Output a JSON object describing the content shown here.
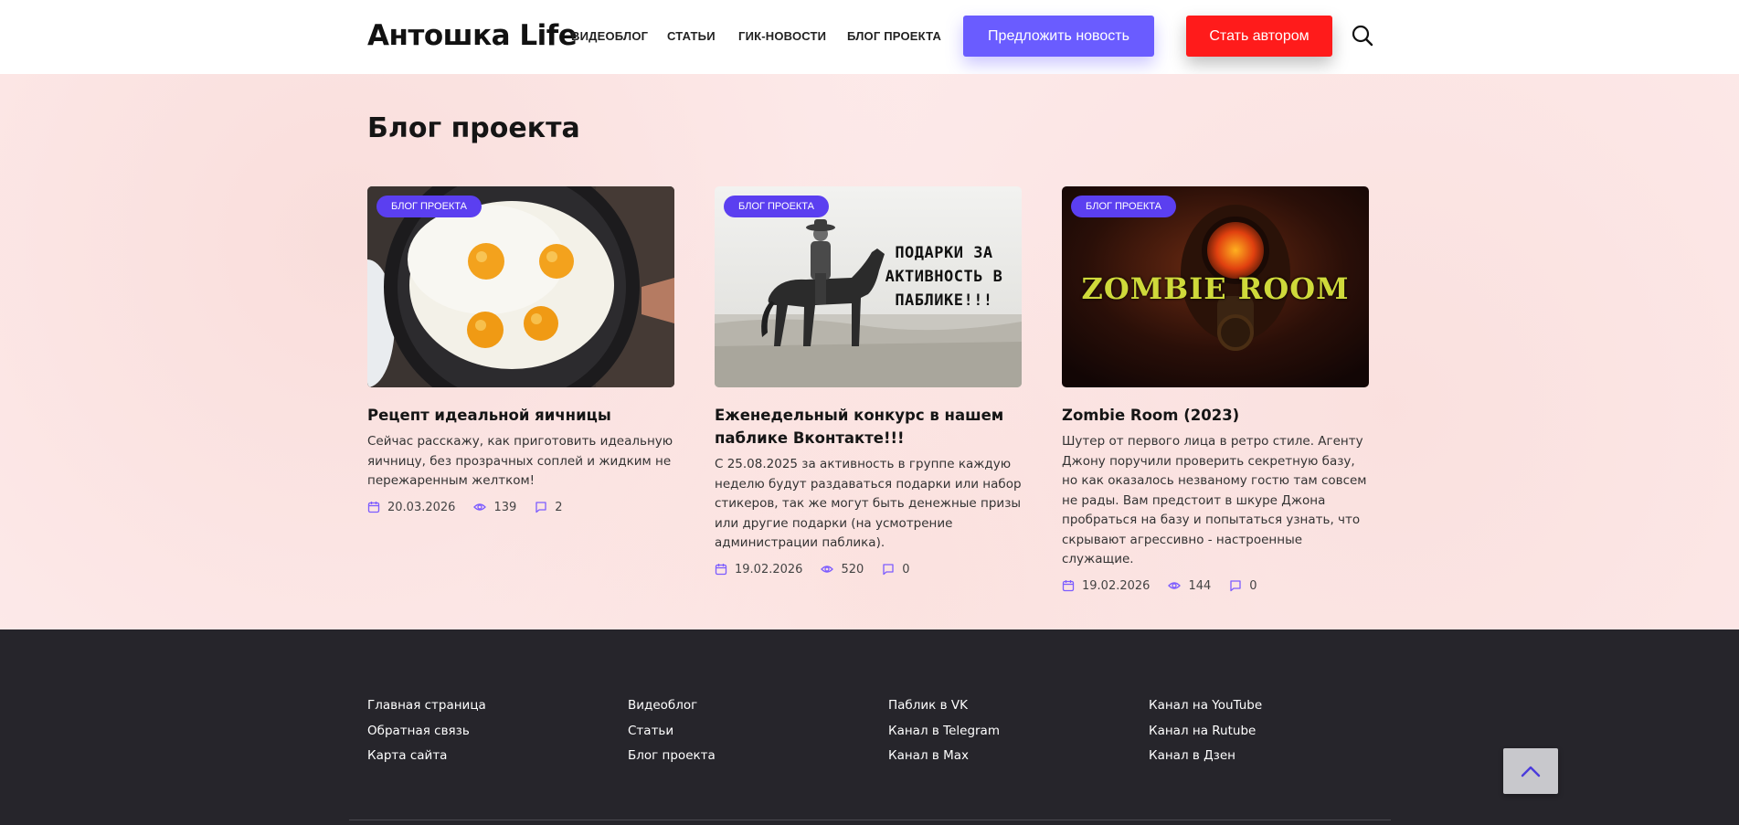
{
  "header": {
    "logo": "Антошка Life",
    "nav": [
      "Видеоблог",
      "Статьи",
      "Гик-новости",
      "Блог проекта"
    ],
    "suggest_button": "Предложить новость",
    "author_button": "Стать автором",
    "search_icon": "search-icon"
  },
  "main": {
    "title": "Блог проекта",
    "cards": [
      {
        "badge": "Блог проекта",
        "image_caption": "",
        "title": "Рецепт идеальной яичницы",
        "text": "Сейчас расскажу, как приготовить идеальную яичницу, без прозрачных соплей и жидким не пережаренным желтком!",
        "date": "20.03.2026",
        "views": "139",
        "comments": "2"
      },
      {
        "badge": "Блог проекта",
        "image_caption": "ПОДАРКИ ЗА АКТИВНОСТЬ В ПАБЛИКЕ!!!",
        "title": "Еженедельный конкурс в нашем паблике Вконтакте!!!",
        "text": "С 25.08.2025 за активность в группе каждую неделю будут раздаваться подарки или набор стикеров, так же могут быть денежные призы или другие подарки (на усмотрение администрации паблика).",
        "date": "19.02.2026",
        "views": "520",
        "comments": "0"
      },
      {
        "badge": "Блог проекта",
        "image_caption": "ZOMBIE ROOM",
        "title": "Zombie Room (2023)",
        "text": "Шутер от первого лица в ретро стиле. Агенту Джону поручили проверить секретную базу, но как оказалось незваному гостю там совсем не рады. Вам предстоит в шкуре Джона пробраться на базу и попытаться узнать, что скрывают агрессивно - настроенные служащие.",
        "date": "19.02.2026",
        "views": "144",
        "comments": "0"
      }
    ]
  },
  "footer": {
    "columns": [
      [
        "Главная страница",
        "Обратная связь",
        "Карта сайта"
      ],
      [
        "Видеоблог",
        "Статьи",
        "Блог проекта"
      ],
      [
        "Паблик в VK",
        "Канал в Telegram",
        "Канал в Max"
      ],
      [
        "Канал на YouTube",
        "Канал на Rutube",
        "Канал в Дзен"
      ]
    ]
  },
  "colors": {
    "accent": "#6a5cff",
    "badge": "#5b3ff0",
    "author_button": "#ff1b1b",
    "footer_bg": "#26252b",
    "main_bg": "#fdeaea"
  }
}
